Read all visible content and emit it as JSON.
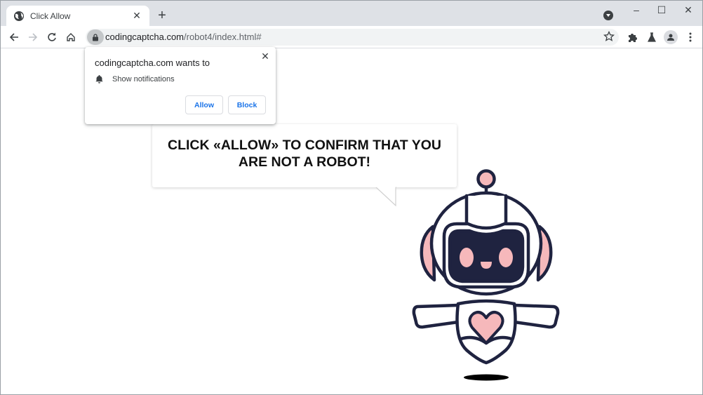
{
  "browser": {
    "tab": {
      "title": "Click Allow",
      "favicon": "globe-icon"
    },
    "address": {
      "domain": "codingcaptcha.com",
      "path": "/robot4/index.html#",
      "security_icon": "lock-icon"
    },
    "toolbar_icons": [
      "back-icon",
      "forward-icon",
      "reload-icon",
      "home-icon",
      "star-icon",
      "extensions-icon",
      "labs-icon",
      "profile-icon",
      "menu-icon"
    ],
    "window_controls": {
      "minimize": "–",
      "maximize": "☐",
      "close": "✕"
    },
    "new_tab": "+",
    "tab_close": "✕"
  },
  "permission_prompt": {
    "title": "codingcaptcha.com wants to",
    "permission": "Show notifications",
    "allow_label": "Allow",
    "block_label": "Block",
    "close": "✕"
  },
  "page": {
    "message_line1": "CLICK «ALLOW» TO CONFIRM THAT YOU",
    "message_line2": "ARE NOT A ROBOT!",
    "illustration": "robot-illustration"
  },
  "colors": {
    "robot_outline": "#1f2340",
    "robot_accent": "#f6b8bb",
    "link_blue": "#1a73e8"
  }
}
